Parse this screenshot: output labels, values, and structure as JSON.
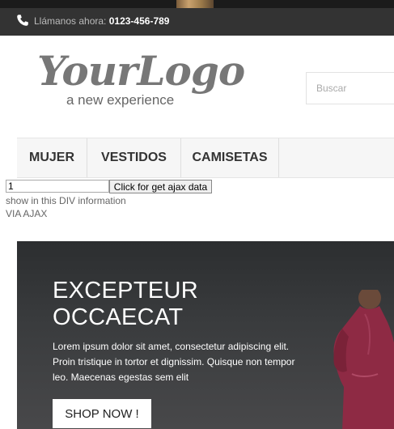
{
  "contact": {
    "label": "Llámanos ahora:",
    "phone": "0123-456-789",
    "icon": "phone-icon"
  },
  "logo": {
    "main": "YourLogo",
    "tagline": "a new experience"
  },
  "search": {
    "placeholder": "Buscar"
  },
  "nav": {
    "items": [
      "MUJER",
      "VESTIDOS",
      "CAMISETAS"
    ]
  },
  "ajax": {
    "input_value": "1",
    "button_label": "Click for get ajax data",
    "line1": "show in this DIV information",
    "line2": "VIA AJAX"
  },
  "hero": {
    "title": "EXCEPTEUR OCCAECAT",
    "text": "Lorem ipsum dolor sit amet, consectetur adipiscing elit. Proin tristique in tortor et dignissim. Quisque non tempor leo. Maecenas egestas sem elit",
    "button": "SHOP NOW !"
  }
}
